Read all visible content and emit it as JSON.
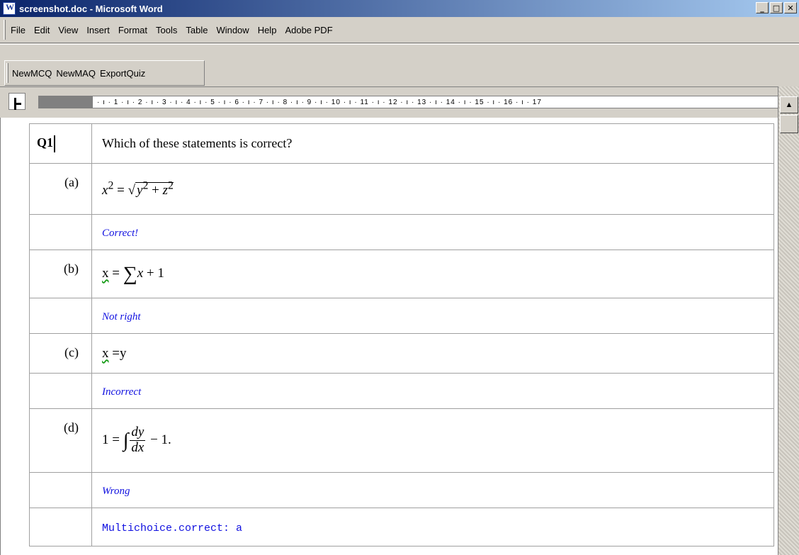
{
  "window": {
    "title": "screenshot.doc - Microsoft Word"
  },
  "menu": [
    "File",
    "Edit",
    "View",
    "Insert",
    "Format",
    "Tools",
    "Table",
    "Window",
    "Help",
    "Adobe PDF"
  ],
  "toolbar": {
    "buttons": [
      "NewMCQ",
      "NewMAQ",
      "ExportQuiz"
    ]
  },
  "ruler": {
    "ticks": "· ı · 1 · ı · 2 · ı · 3 · ı · 4 · ı · 5 · ı · 6 · ı · 7 · ı · 8 · ı · 9 · ı · 10 · ı · 11 · ı · 12 · ı · 13 · ı · 14 · ı · 15 · ı · 16 · ı · 17"
  },
  "question": {
    "label": "Q1",
    "text": "Which of these statements is correct?",
    "options": [
      {
        "label": "(a)",
        "feedback": "Correct!"
      },
      {
        "label": "(b)",
        "feedback": "Not right"
      },
      {
        "label": "(c)",
        "feedback": "Incorrect"
      },
      {
        "label": "(d)",
        "feedback": "Wrong"
      }
    ],
    "meta": "Multichoice.correct: a"
  },
  "colors": {
    "feedback": "#1010e0",
    "titlebar": "#0a246a"
  },
  "icons": [
    "word-doc-icon",
    "minimize-icon",
    "maximize-icon",
    "close-icon",
    "scroll-up-icon"
  ]
}
